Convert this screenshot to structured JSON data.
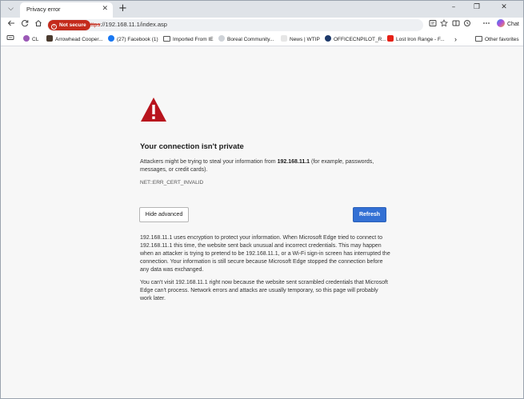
{
  "tabs": {
    "active_title": "Privacy error",
    "close_glyph": "✕",
    "new_tab_glyph": "+",
    "menu_glyph": "⌵"
  },
  "window": {
    "minimize": "–",
    "restore": "❐",
    "close": "✕"
  },
  "address_bar": {
    "security_label": "Not secure",
    "url_scheme": "https",
    "url_rest": "://192.168.11.1/index.asp"
  },
  "toolbar": {
    "chat_label": "Chat"
  },
  "favorites": {
    "items": [
      {
        "label": "CL",
        "icon": "peace-icon"
      },
      {
        "label": "Arrowhead Cooper...",
        "icon": "arrowhead-icon"
      },
      {
        "label": "(27) Facebook (1)",
        "icon": "facebook-icon"
      },
      {
        "label": "Imported From IE",
        "icon": "folder-icon"
      },
      {
        "label": "Boreal Community...",
        "icon": "boreal-icon"
      },
      {
        "label": "News | WTIP",
        "icon": "wtip-icon"
      },
      {
        "label": "OFFICECNPILOT_R...",
        "icon": "officecn-icon"
      },
      {
        "label": "Lost Iron Range - F...",
        "icon": "youtube-icon"
      }
    ],
    "other_favorites": "Other favorites"
  },
  "error_page": {
    "heading": "Your connection isn't private",
    "intro_before": "Attackers might be trying to steal your information from ",
    "host": "192.168.11.1",
    "intro_after": " (for example, passwords, messages, or credit cards).",
    "error_code": "NET::ERR_CERT_INVALID",
    "hide_advanced": "Hide advanced",
    "refresh": "Refresh",
    "advanced_text": "192.168.11.1 uses encryption to protect your information. When Microsoft Edge tried to connect to 192.168.11.1 this time, the website sent back unusual and incorrect credentials. This may happen when an attacker is trying to pretend to be 192.168.11.1, or a Wi-Fi sign-in screen has interrupted the connection. Your information is still secure because Microsoft Edge stopped the connection before any data was exchanged.",
    "cannot_visit_text": "You can't visit 192.168.11.1 right now because the website sent scrambled credentials that Microsoft Edge can't process. Network errors and attacks are usually temporary, so this page will probably work later."
  },
  "colors": {
    "warning_red": "#b8141d",
    "not_secure_red": "#c42b1c",
    "refresh_blue": "#3370d4"
  }
}
